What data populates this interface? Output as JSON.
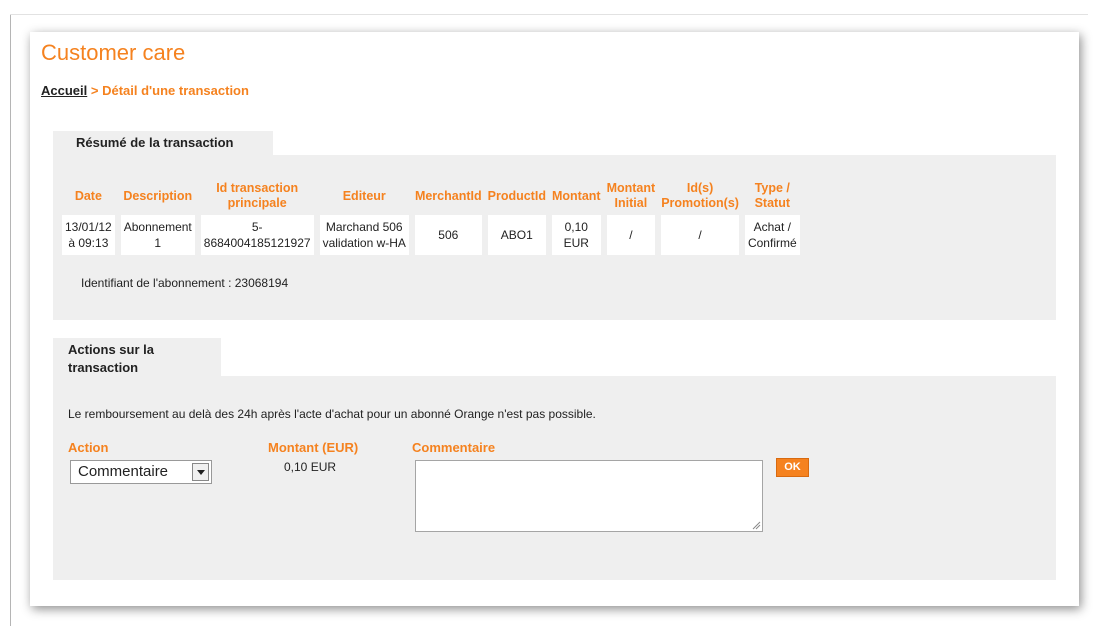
{
  "page_title": "Customer care",
  "breadcrumb": {
    "home": "Accueil",
    "separator": ">",
    "current": "Détail d'une transaction"
  },
  "summary": {
    "tab_label": "Résumé de la transaction",
    "columns": [
      [
        "Date"
      ],
      [
        "Description"
      ],
      [
        "Id transaction",
        "principale"
      ],
      [
        "Editeur"
      ],
      [
        "MerchantId"
      ],
      [
        "ProductId"
      ],
      [
        "Montant"
      ],
      [
        "Montant",
        "Initial"
      ],
      [
        "Id(s)",
        "Promotion(s)"
      ],
      [
        "Type /",
        "Statut"
      ]
    ],
    "row": [
      [
        "13/01/12",
        "à 09:13"
      ],
      [
        "Abonnement",
        "1"
      ],
      [
        "5-",
        "8684004185121927"
      ],
      [
        "Marchand 506",
        "validation w-HA"
      ],
      [
        "506"
      ],
      [
        "ABO1"
      ],
      [
        "0,10",
        "EUR"
      ],
      [
        "/"
      ],
      [
        "/"
      ],
      [
        "Achat /",
        "Confirmé"
      ]
    ],
    "subscription_id": "Identifiant de l'abonnement : 23068194"
  },
  "actions": {
    "tab_label": "Actions sur la transaction",
    "notice": "Le remboursement au delà des 24h après l'acte d'achat pour un abonné Orange n'est pas possible.",
    "action_label": "Action",
    "action_selected": "Commentaire",
    "amount_label": "Montant (EUR)",
    "amount_value": "0,10 EUR",
    "comment_label": "Commentaire",
    "comment_value": "",
    "ok_label": "OK"
  },
  "colors": {
    "accent": "#f5821f",
    "section_bg": "#efefef"
  }
}
